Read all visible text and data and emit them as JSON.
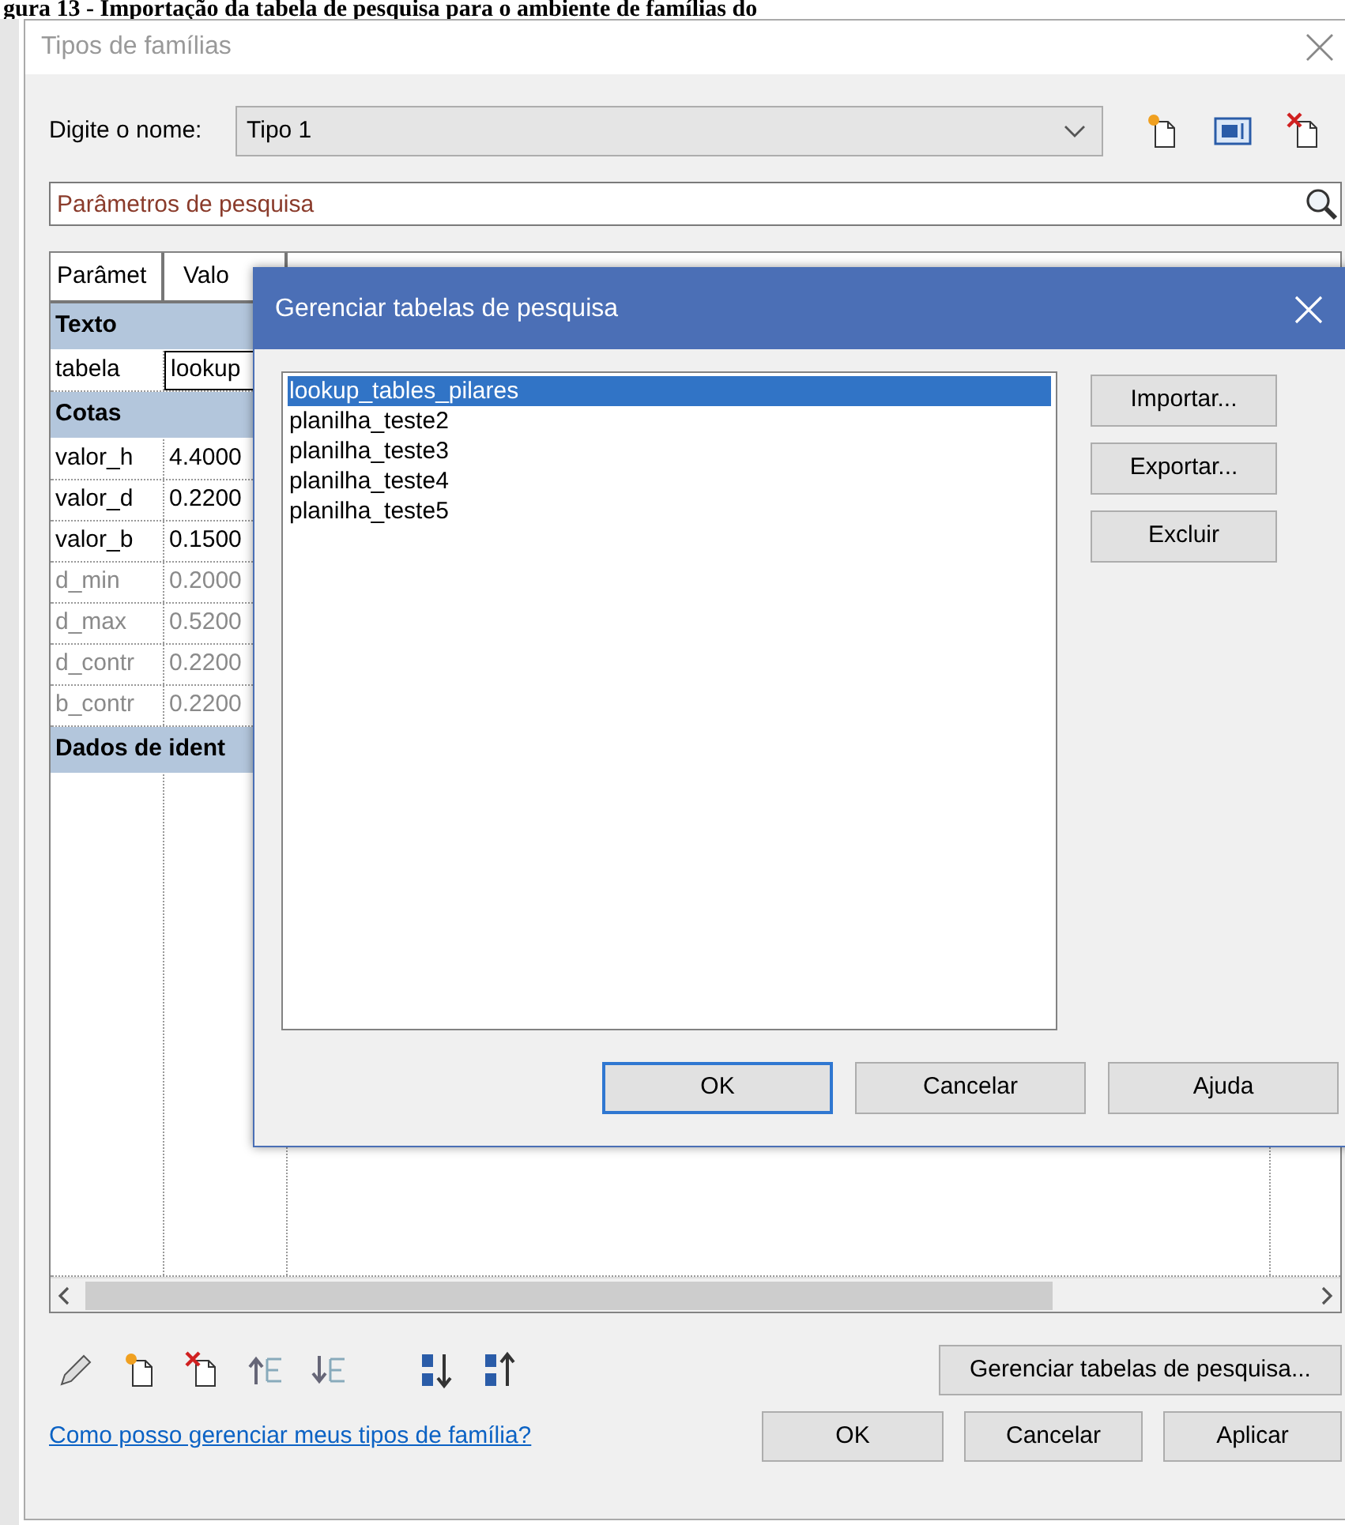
{
  "caption": "gura 13 - Importação da tabela de pesquisa para o ambiente de famílias do",
  "dialog": {
    "title": "Tipos de famílias",
    "name_label": "Digite o nome:",
    "type_value": "Tipo 1",
    "search": {
      "placeholder": "Parâmetros de pesquisa"
    },
    "table": {
      "columns": [
        "Parâmet",
        "Valo"
      ],
      "groups": [
        {
          "label": "Texto",
          "rows": [
            {
              "name": "tabela",
              "value": "lookup",
              "editing": true,
              "disabled": false
            }
          ]
        },
        {
          "label": "Cotas",
          "rows": [
            {
              "name": "valor_h",
              "value": "4.4000",
              "editing": false,
              "disabled": false
            },
            {
              "name": "valor_d",
              "value": "0.2200",
              "editing": false,
              "disabled": false
            },
            {
              "name": "valor_b",
              "value": "0.1500",
              "editing": false,
              "disabled": false
            },
            {
              "name": "d_min",
              "value": "0.2000",
              "editing": false,
              "disabled": true
            },
            {
              "name": "d_max",
              "value": "0.5200",
              "editing": false,
              "disabled": true
            },
            {
              "name": "d_contr",
              "value": "0.2200",
              "editing": false,
              "disabled": true
            },
            {
              "name": "b_contr",
              "value": "0.2200",
              "editing": false,
              "disabled": true
            }
          ]
        },
        {
          "label": "Dados de ident"
        }
      ]
    },
    "manage_button": "Gerenciar tabelas de pesquisa...",
    "help_link": "Como posso gerenciar meus tipos de família?",
    "buttons": [
      "OK",
      "Cancelar",
      "Aplicar"
    ]
  },
  "modal": {
    "title": "Gerenciar tabelas de pesquisa",
    "items": [
      {
        "label": "lookup_tables_pilares",
        "selected": true
      },
      {
        "label": "planilha_teste2",
        "selected": false
      },
      {
        "label": "planilha_teste3",
        "selected": false
      },
      {
        "label": "planilha_teste4",
        "selected": false
      },
      {
        "label": "planilha_teste5",
        "selected": false
      }
    ],
    "side_buttons": [
      "Importar...",
      "Exportar...",
      "Excluir"
    ],
    "buttons": [
      {
        "label": "OK",
        "focused": true
      },
      {
        "label": "Cancelar",
        "focused": false
      },
      {
        "label": "Ajuda",
        "focused": false
      }
    ]
  }
}
